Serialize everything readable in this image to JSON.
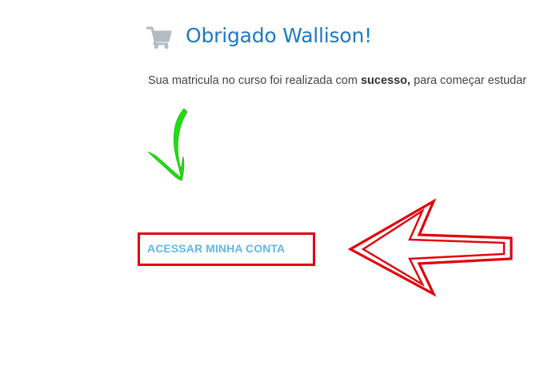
{
  "header": {
    "icon": "shopping-cart-icon",
    "title": "Obrigado Wallison!"
  },
  "message": {
    "before": "Sua matricula no curso foi realizada com ",
    "bold": "sucesso,",
    "after": " para começar estudar"
  },
  "cta": {
    "label": "ACESSAR MINHA CONTA"
  },
  "annotations": {
    "green_arrow": "hand-drawn-green-arrow-down",
    "red_arrow": "red-outline-arrow-left",
    "accent_green": "#22dd10",
    "accent_red": "#e0000b"
  },
  "colors": {
    "title": "#1f78c4",
    "cta_text": "#62b7e8",
    "icon": "#b4bcc2"
  }
}
